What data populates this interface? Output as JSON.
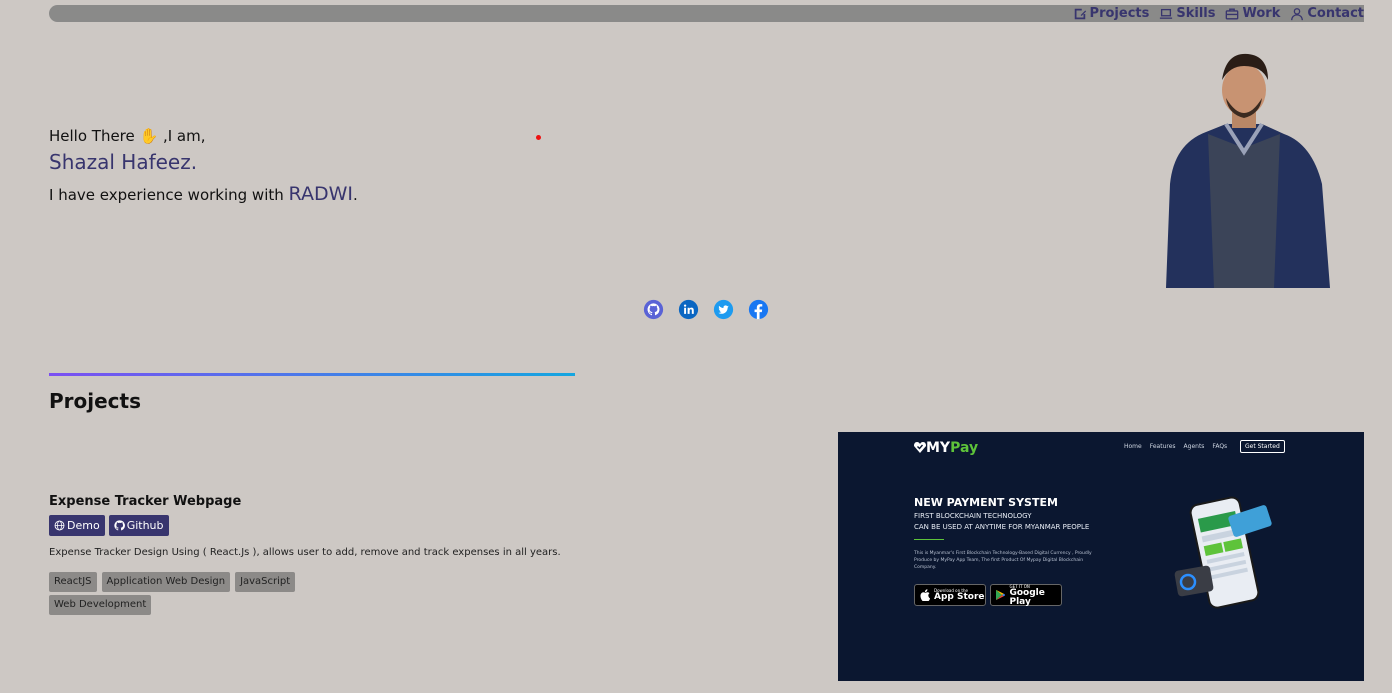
{
  "nav": {
    "items": [
      {
        "icon": "edit-icon",
        "label": "Projects"
      },
      {
        "icon": "laptop-icon",
        "label": "Skills"
      },
      {
        "icon": "briefcase-icon",
        "label": "Work"
      },
      {
        "icon": "user-icon",
        "label": "Contact"
      }
    ]
  },
  "hero": {
    "greeting": "Hello There ✋ ,I am,",
    "name": "Shazal Hafeez.",
    "experience_prefix": "I have experience working with ",
    "experience_highlight": "RADWI",
    "experience_suffix": "."
  },
  "social": [
    "github-icon",
    "linkedin-icon",
    "twitter-icon",
    "facebook-icon"
  ],
  "projects": {
    "section_title": "Projects",
    "items": [
      {
        "title": "Expense Tracker Webpage",
        "demo_label": "Demo",
        "github_label": "Github",
        "description": "Expense Tracker Design Using ( React.Js ), allows user to add, remove and track expenses in all years.",
        "tags": [
          "ReactJS",
          "Application Web Design",
          "JavaScript",
          "Web Development"
        ]
      }
    ]
  },
  "preview": {
    "logo_main": "MY",
    "logo_accent": "Pay",
    "nav": [
      "Home",
      "Features",
      "Agents",
      "FAQs"
    ],
    "cta": "Get Started",
    "heading": "NEW PAYMENT SYSTEM",
    "sub1": "FIRST BLOCKCHAIN TECHNOLOGY",
    "sub2": "CAN BE USED AT ANYTIME FOR MYANMAR PEOPLE",
    "paragraph": "This is Myanmar's First Blockchain Technology-Based Digital Currency , Proudly Produce by MyPay App Team, The first Product Of Mypay Digital Blockchain Company.",
    "appstore_small": "Download on the",
    "appstore_big": "App Store",
    "play_small": "GET IT ON",
    "play_big": "Google Play"
  },
  "colors": {
    "background": "#cdc8c4",
    "accent": "#38356e",
    "preview_bg": "#0b1730",
    "preview_green": "#5ec33a"
  }
}
